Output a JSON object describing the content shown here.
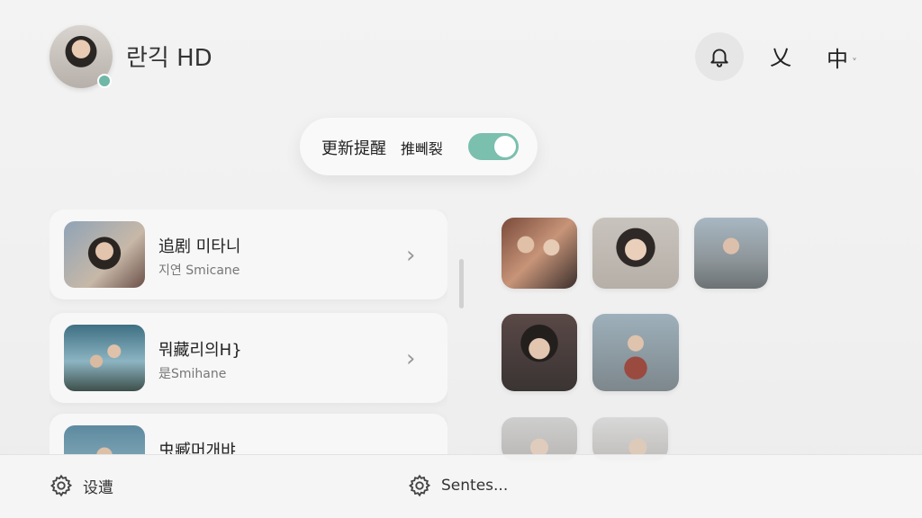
{
  "header": {
    "title": "란긱 HD",
    "bell_icon": "bell-icon",
    "collapse_label": "乂",
    "lang_label": "中",
    "lang_chevron": "˅"
  },
  "update_toggle": {
    "label": "更新提醒",
    "sub_label": "推뻬裂",
    "enabled": true,
    "accent_color": "#7bbfae"
  },
  "list": {
    "items": [
      {
        "title": "追剧 미타니",
        "subtitle": "지연 Smicane"
      },
      {
        "title": "뭐藏리의H}",
        "subtitle": "是Smihane"
      },
      {
        "title": "虫臧머개뱌",
        "subtitle": ""
      }
    ]
  },
  "bottom_bar": {
    "settings_label": "设遭",
    "sentes_label": "Sentes..."
  }
}
